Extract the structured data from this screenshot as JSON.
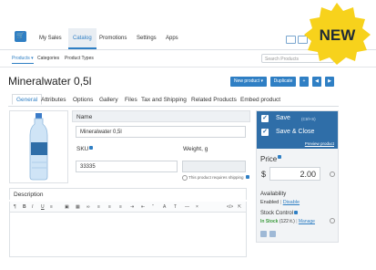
{
  "nav": {
    "items": [
      "My Sales",
      "Catalog",
      "Promotions",
      "Settings",
      "Apps"
    ]
  },
  "subnav": {
    "items": [
      "Products",
      "Categories",
      "Product Types"
    ],
    "search_placeholder": "Search Products"
  },
  "product": {
    "title": "Mineralwater 0,5l",
    "new_product_label": "New product",
    "duplicate_label": "Duplicate"
  },
  "tabs": [
    "General",
    "Attributes",
    "Options",
    "Gallery",
    "Files",
    "Tax and Shipping",
    "Related Products",
    "Embed product"
  ],
  "form": {
    "name_label": "Name",
    "name_value": "Mineralwater 0,5l",
    "sku_label": "SKU",
    "sku_value": "33335",
    "weight_label": "Weight, g",
    "requires_shipping": "This product requires shipping",
    "description_label": "Description"
  },
  "sidebar": {
    "save_label": "Save",
    "save_shortcut": "(Ctrl+S)",
    "save_close_label": "Save & Close",
    "preview_label": "Preview product",
    "price_label": "Price",
    "currency": "$",
    "price_value": "2.00",
    "availability_label": "Availability",
    "availability_status": "Enabled",
    "availability_action": "Disable",
    "stock_label": "Stock Control",
    "stock_status": "In Stock",
    "stock_count": "(122 it.)",
    "stock_action": "Manage"
  },
  "badge": {
    "text": "NEW"
  },
  "colors": {
    "accent": "#2f7fc4",
    "save_panel": "#2f6ea8",
    "badge_yellow": "#f7d21c",
    "stock_green": "#3c9a3c"
  }
}
